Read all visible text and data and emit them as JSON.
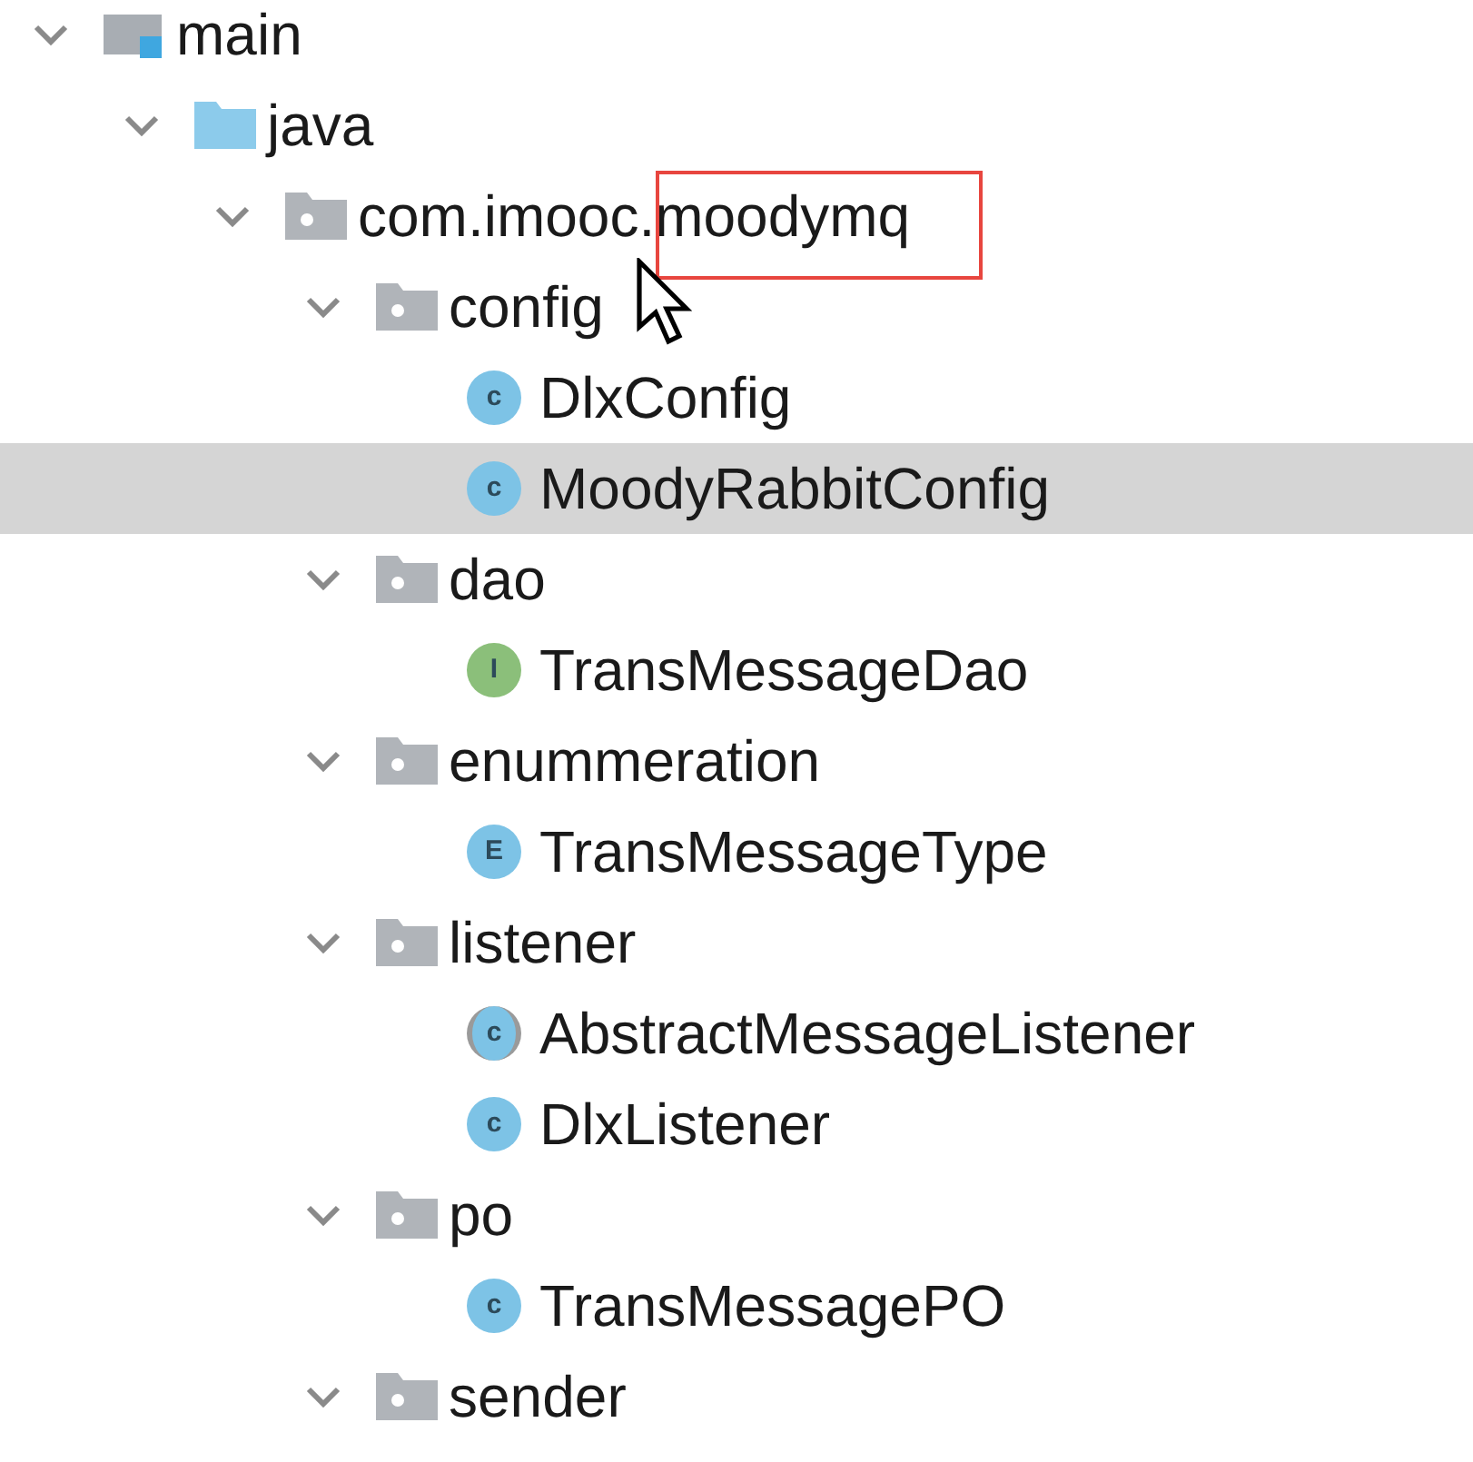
{
  "tree": [
    {
      "kind": "module",
      "label": "main",
      "expanded": true,
      "selected": false,
      "children": [
        {
          "kind": "source-root",
          "label": "java",
          "expanded": true,
          "selected": false,
          "children": [
            {
              "kind": "package",
              "label": "com.imooc.moodymq",
              "expanded": true,
              "selected": false,
              "annotated": true,
              "children": [
                {
                  "kind": "package",
                  "label": "config",
                  "expanded": true,
                  "selected": false,
                  "children": [
                    {
                      "kind": "class",
                      "icon_letter": "c",
                      "label": "DlxConfig",
                      "selected": false
                    },
                    {
                      "kind": "class",
                      "icon_letter": "c",
                      "label": "MoodyRabbitConfig",
                      "selected": true
                    }
                  ]
                },
                {
                  "kind": "package",
                  "label": "dao",
                  "expanded": true,
                  "selected": false,
                  "children": [
                    {
                      "kind": "interface",
                      "icon_letter": "I",
                      "label": "TransMessageDao",
                      "selected": false
                    }
                  ]
                },
                {
                  "kind": "package",
                  "label": "enummeration",
                  "expanded": true,
                  "selected": false,
                  "children": [
                    {
                      "kind": "enum",
                      "icon_letter": "E",
                      "label": "TransMessageType",
                      "selected": false
                    }
                  ]
                },
                {
                  "kind": "package",
                  "label": "listener",
                  "expanded": true,
                  "selected": false,
                  "children": [
                    {
                      "kind": "abstract",
                      "icon_letter": "c",
                      "label": "AbstractMessageListener",
                      "selected": false
                    },
                    {
                      "kind": "class",
                      "icon_letter": "c",
                      "label": "DlxListener",
                      "selected": false
                    }
                  ]
                },
                {
                  "kind": "package",
                  "label": "po",
                  "expanded": true,
                  "selected": false,
                  "children": [
                    {
                      "kind": "class",
                      "icon_letter": "c",
                      "label": "TransMessagePO",
                      "selected": false
                    }
                  ]
                },
                {
                  "kind": "package",
                  "label": "sender",
                  "expanded": true,
                  "selected": false
                }
              ]
            }
          ]
        }
      ]
    }
  ]
}
